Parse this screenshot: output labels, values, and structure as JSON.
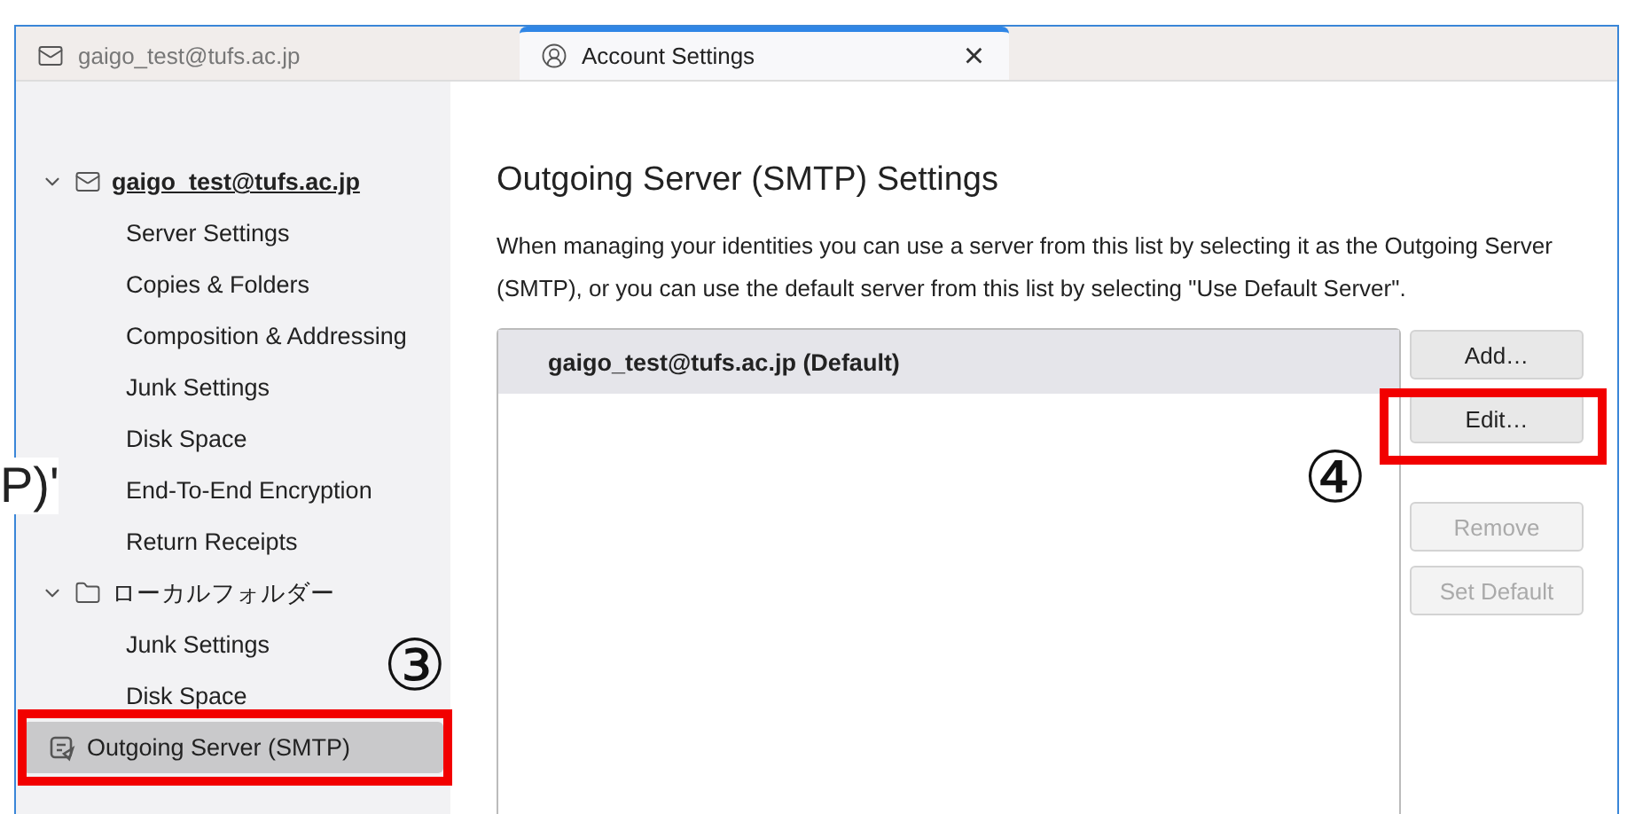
{
  "tabs": [
    {
      "label": "gaigo_test@tufs.ac.jp",
      "kind": "mail",
      "selected": false
    },
    {
      "label": "Account Settings",
      "kind": "account",
      "selected": true,
      "close": "×"
    }
  ],
  "sidebar": {
    "accounts": [
      {
        "label": "gaigo_test@tufs.ac.jp",
        "kind": "mail",
        "expanded": true,
        "children": [
          {
            "label": "Server Settings",
            "selected": false
          },
          {
            "label": "Copies & Folders",
            "selected": false
          },
          {
            "label": "Composition & Addressing",
            "selected": false
          },
          {
            "label": "Junk Settings",
            "selected": false
          },
          {
            "label": "Disk Space",
            "selected": false
          },
          {
            "label": "End-To-End Encryption",
            "selected": false
          },
          {
            "label": "Return Receipts",
            "selected": false
          }
        ]
      },
      {
        "label": "ローカルフォルダー",
        "kind": "folder",
        "expanded": true,
        "children": [
          {
            "label": "Junk Settings",
            "selected": false
          },
          {
            "label": "Disk Space",
            "selected": false
          }
        ]
      }
    ],
    "items": [
      {
        "label": "Outgoing Server (SMTP)",
        "selected": true
      }
    ]
  },
  "content": {
    "title": "Outgoing Server (SMTP) Settings",
    "description": "When managing your identities you can use a server from this list by selecting it as the Outgoing Server (SMTP), or you can use the default server from this list by selecting \"Use Default Server\".",
    "servers": [
      {
        "label": "gaigo_test@tufs.ac.jp (Default)",
        "selected": true
      }
    ],
    "buttons": [
      {
        "label": "Add…",
        "disabled": false
      },
      {
        "label": "Edit…",
        "disabled": false
      },
      {
        "label": "Remove",
        "disabled": true
      },
      {
        "label": "Set Default",
        "disabled": true
      }
    ]
  },
  "annotations": {
    "background_text": "P)'",
    "callouts": [
      {
        "label": "③"
      },
      {
        "label": "④"
      }
    ]
  }
}
